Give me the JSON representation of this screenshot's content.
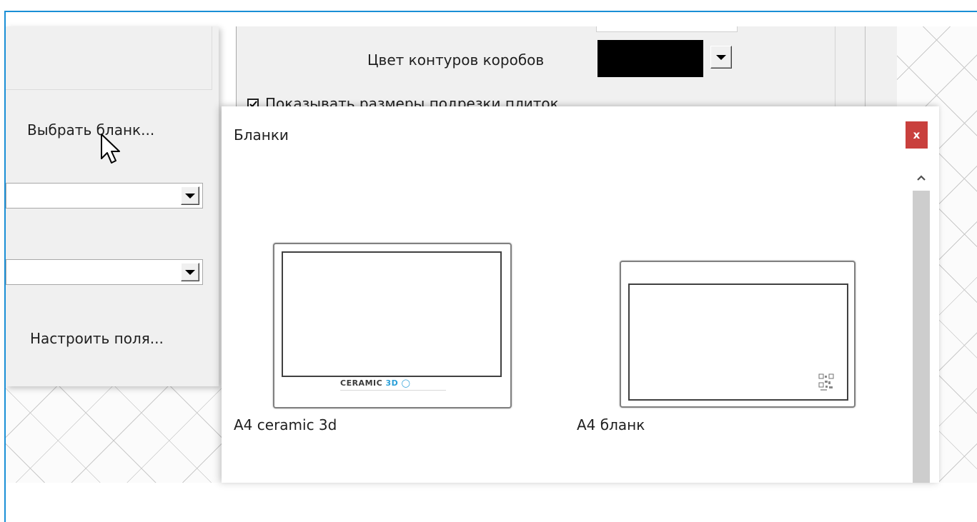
{
  "left_panel": {
    "choose_form_button": "Выбрать бланк...",
    "setup_margins_button": "Настроить поля..."
  },
  "settings": {
    "box_outline_color_label": "Цвет контуров коробов",
    "box_outline_color_value": "#000000",
    "show_tile_cut_sizes_label": "Показывать размеры подрезки плиток",
    "show_tile_cut_sizes_checked": true
  },
  "dialog": {
    "title": "Бланки",
    "close_label": "x",
    "templates": [
      {
        "label": "A4 ceramic 3d",
        "logo_main": "CERAMIC",
        "logo_accent": "3D"
      },
      {
        "label": "A4 бланк"
      }
    ]
  },
  "colors": {
    "accent_border": "#1a8fd6",
    "close_button": "#c9403d",
    "logo_accent": "#2a9fd8"
  }
}
